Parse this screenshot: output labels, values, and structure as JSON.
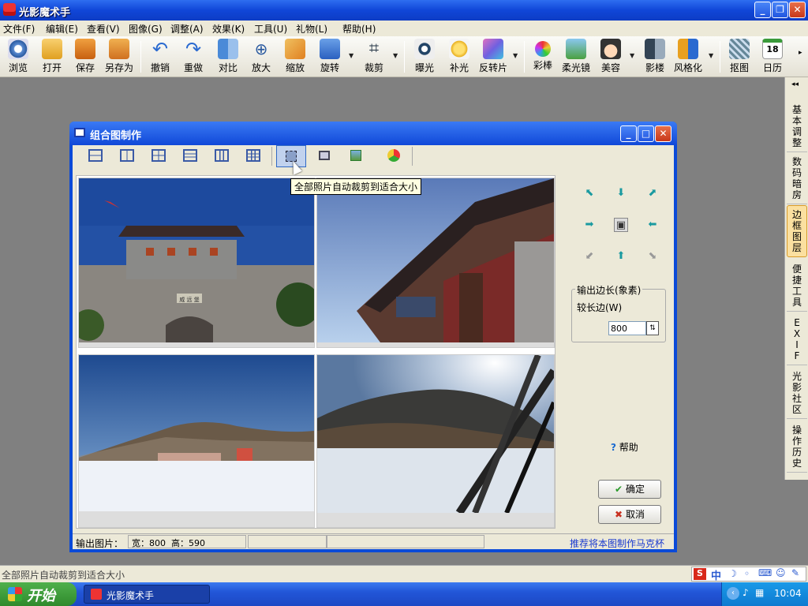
{
  "app": {
    "title": "光影魔术手"
  },
  "menu": [
    "文件(F)",
    "编辑(E)",
    "查看(V)",
    "图像(G)",
    "调整(A)",
    "效果(K)",
    "工具(U)",
    "礼物(L)",
    "帮助(H)"
  ],
  "toolbar": [
    "浏览",
    "打开",
    "保存",
    "另存为",
    "撤销",
    "重做",
    "对比",
    "放大",
    "缩放",
    "旋转",
    "裁剪",
    "曝光",
    "补光",
    "反转片",
    "彩棒",
    "柔光镜",
    "美容",
    "影楼",
    "风格化",
    "抠图",
    "日历"
  ],
  "calendar_day": "18",
  "side_tabs": [
    "基本调整",
    "数码暗房",
    "边框图层",
    "便捷工具",
    "EXIF",
    "光影社区",
    "操作历史"
  ],
  "dialog": {
    "title": "组合图制作",
    "tooltip": "全部照片自动裁剪到适合大小",
    "output_group": "输出边长(象素)",
    "longer_edge_label": "较长边(W)",
    "longer_edge_value": "800",
    "help": "帮助",
    "ok": "确定",
    "cancel": "取消",
    "status_label": "输出图片：",
    "status_size": "宽：800  高：590",
    "status_link": "推荐将本图制作马克杯",
    "plaque_text": "威 远 堡"
  },
  "statusbar": {
    "text": "全部照片自动裁剪到适合大小",
    "ime": "中"
  },
  "taskbar": {
    "start": "开始",
    "task": "光影魔术手",
    "clock": "10:04"
  }
}
